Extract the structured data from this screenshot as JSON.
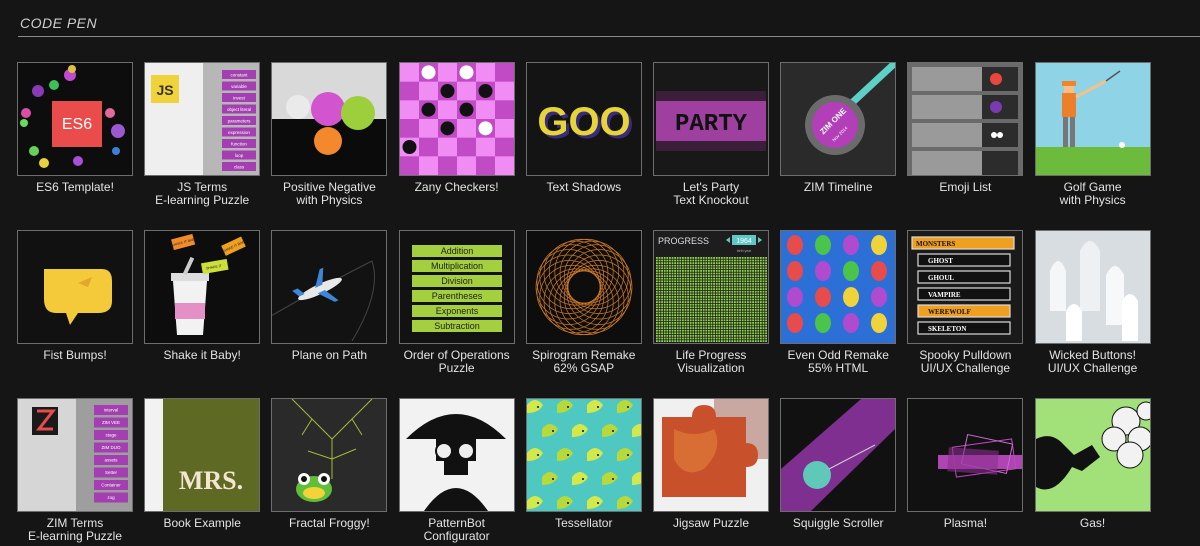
{
  "header": {
    "title": "CODE PEN"
  },
  "rows": [
    [
      {
        "id": "es6-template",
        "lines": [
          "ES6 Template!"
        ],
        "badge": "ES6"
      },
      {
        "id": "js-terms",
        "lines": [
          "JS Terms",
          "E-learning Puzzle"
        ],
        "badge": "JS",
        "terms": [
          "constant",
          "variable",
          "invest",
          "object literal",
          "parameters",
          "expression",
          "function",
          "loop",
          "class"
        ]
      },
      {
        "id": "positive-negative",
        "lines": [
          "Positive Negative",
          "with Physics"
        ]
      },
      {
        "id": "zany-checkers",
        "lines": [
          "Zany Checkers!"
        ]
      },
      {
        "id": "text-shadows",
        "lines": [
          "Text Shadows"
        ],
        "badge": "GOO"
      },
      {
        "id": "lets-party",
        "lines": [
          "Let's Party",
          "Text Knockout"
        ],
        "badge": "PARTY"
      },
      {
        "id": "zim-timeline",
        "lines": [
          "ZIM Timeline"
        ],
        "badge": "ZIM ONE",
        "sub": "Nov 2014"
      },
      {
        "id": "emoji-list",
        "lines": [
          "Emoji List"
        ]
      },
      {
        "id": "golf-game",
        "lines": [
          "Golf Game",
          "with Physics"
        ]
      }
    ],
    [
      {
        "id": "fist-bumps",
        "lines": [
          "Fist Bumps!"
        ]
      },
      {
        "id": "shake-it-baby",
        "lines": [
          "Shake it Baby!"
        ],
        "tags": [
          "SHAKE IT BABY",
          "SHAKE IT",
          "SHAKE IT BABY"
        ]
      },
      {
        "id": "plane-on-path",
        "lines": [
          "Plane on Path"
        ]
      },
      {
        "id": "order-of-operations",
        "lines": [
          "Order of Operations",
          "Puzzle"
        ],
        "ops": [
          "Addition",
          "Multiplication",
          "Division",
          "Parentheses",
          "Exponents",
          "Subtraction"
        ]
      },
      {
        "id": "spirogram-remake",
        "lines": [
          "Spirogram Remake",
          "62% GSAP"
        ]
      },
      {
        "id": "life-progress",
        "lines": [
          "Life Progress",
          "Visualization"
        ],
        "label": "PROGRESS",
        "year": "1964",
        "sub": "birth year"
      },
      {
        "id": "even-odd-remake",
        "lines": [
          "Even Odd Remake",
          "55% HTML"
        ]
      },
      {
        "id": "spooky-pulldown",
        "lines": [
          "Spooky Pulldown",
          "UI/UX Challenge"
        ],
        "menu": [
          "MONSTERS",
          "GHOST",
          "GHOUL",
          "VAMPIRE",
          "WEREWOLF",
          "SKELETON"
        ]
      },
      {
        "id": "wicked-buttons",
        "lines": [
          "Wicked Buttons!",
          "UI/UX Challenge"
        ]
      }
    ],
    [
      {
        "id": "zim-terms",
        "lines": [
          "ZIM Terms",
          "E-learning Puzzle"
        ],
        "terms": [
          "interval",
          "ZIM VEE",
          "stage",
          "ZIM DUO",
          "assets",
          "Setter",
          "Container",
          "zog"
        ]
      },
      {
        "id": "book-example",
        "lines": [
          "Book Example"
        ],
        "badge": "MRS."
      },
      {
        "id": "fractal-froggy",
        "lines": [
          "Fractal Froggy!"
        ]
      },
      {
        "id": "patternbot",
        "lines": [
          "PatternBot",
          "Configurator"
        ]
      },
      {
        "id": "tessellator",
        "lines": [
          "Tessellator"
        ]
      },
      {
        "id": "jigsaw-puzzle",
        "lines": [
          "Jigsaw Puzzle"
        ]
      },
      {
        "id": "squiggle-scroller",
        "lines": [
          "Squiggle Scroller"
        ]
      },
      {
        "id": "plasma",
        "lines": [
          "Plasma!"
        ]
      },
      {
        "id": "gas",
        "lines": [
          "Gas!"
        ]
      }
    ]
  ]
}
